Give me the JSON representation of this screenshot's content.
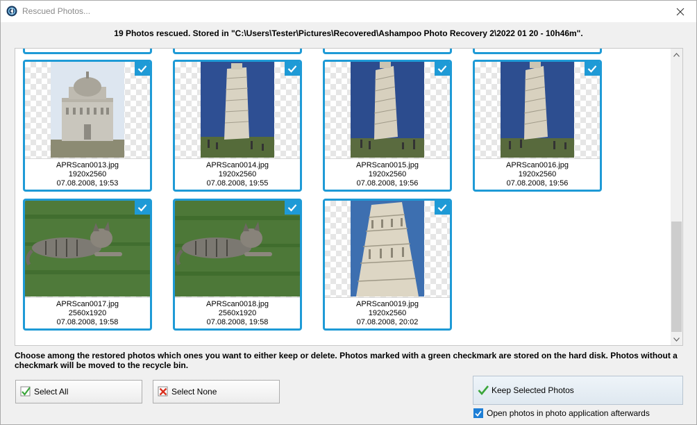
{
  "window": {
    "title": "Rescued Photos...",
    "header_message": "19 Photos rescued. Stored in \"C:\\Users\\Tester\\Pictures\\Recovered\\Ashampoo Photo Recovery 2\\2022 01 20 - 10h46m\"."
  },
  "photos": [
    {
      "name": "APRScan0013.jpg",
      "size": "1920x2560",
      "date": "07.08.2008, 19:53",
      "checked": true,
      "subject": "baptistery"
    },
    {
      "name": "APRScan0014.jpg",
      "size": "1920x2560",
      "date": "07.08.2008, 19:55",
      "checked": true,
      "subject": "leaning-tower"
    },
    {
      "name": "APRScan0015.jpg",
      "size": "1920x2560",
      "date": "07.08.2008, 19:56",
      "checked": true,
      "subject": "leaning-tower"
    },
    {
      "name": "APRScan0016.jpg",
      "size": "1920x2560",
      "date": "07.08.2008, 19:56",
      "checked": true,
      "subject": "leaning-tower"
    },
    {
      "name": "APRScan0017.jpg",
      "size": "2560x1920",
      "date": "07.08.2008, 19:58",
      "checked": true,
      "subject": "cat-on-grass"
    },
    {
      "name": "APRScan0018.jpg",
      "size": "2560x1920",
      "date": "07.08.2008, 19:58",
      "checked": true,
      "subject": "cat-on-grass"
    },
    {
      "name": "APRScan0019.jpg",
      "size": "1920x2560",
      "date": "07.08.2008, 20:02",
      "checked": true,
      "subject": "tower-closeup"
    }
  ],
  "info_text": "Choose among the restored photos which ones you want to either keep or delete. Photos marked with a green checkmark are stored on the hard disk. Photos without a checkmark will be moved to the recycle bin.",
  "buttons": {
    "select_all": "Select All",
    "select_none": "Select None",
    "keep_selected": "Keep Selected Photos"
  },
  "open_after": {
    "label": "Open photos in photo application afterwards",
    "checked": true
  },
  "colors": {
    "accent": "#1e9ad6",
    "check_green": "#3aa53a",
    "cross_red": "#d9301e"
  }
}
